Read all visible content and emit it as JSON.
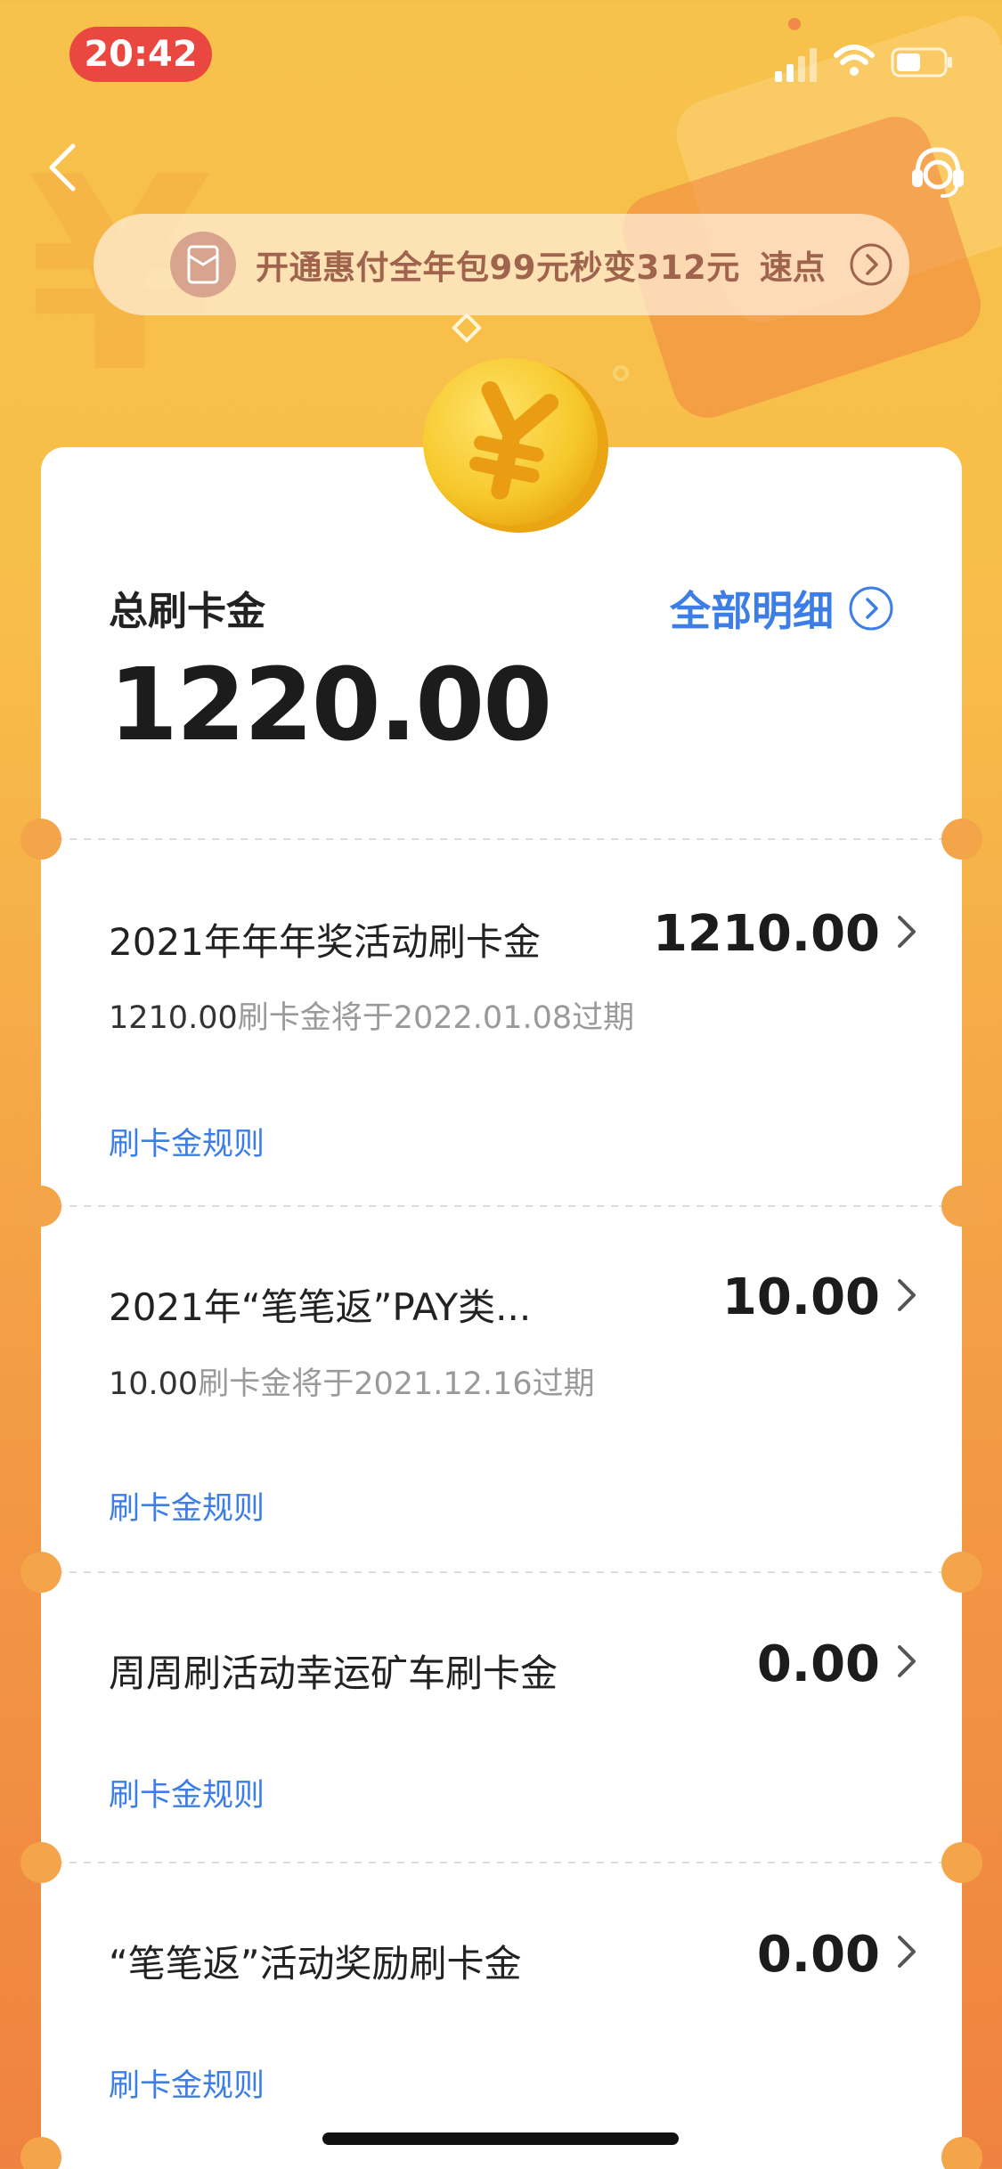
{
  "status_bar": {
    "time": "20:42"
  },
  "promo": {
    "text": "开通惠付全年包99元秒变312元",
    "cta": "速点"
  },
  "summary": {
    "label": "总刷卡金",
    "detail_link": "全部明细",
    "total": "1220.00"
  },
  "items": [
    {
      "title": "2021年年年奖活动刷卡金",
      "amount": "1210.00",
      "sub_amount": "1210.00",
      "sub_rest": "刷卡金将于2022.01.08过期",
      "rule": "刷卡金规则"
    },
    {
      "title": "2021年“笔笔返”PAY类...",
      "amount": "10.00",
      "sub_amount": "10.00",
      "sub_rest": "刷卡金将于2021.12.16过期",
      "rule": "刷卡金规则"
    },
    {
      "title": "周周刷活动幸运矿车刷卡金",
      "amount": "0.00",
      "rule": "刷卡金规则"
    },
    {
      "title": "“笔笔返”活动奖励刷卡金",
      "amount": "0.00",
      "rule": "刷卡金规则"
    }
  ],
  "colors": {
    "accent_blue": "#3c7ee6",
    "time_pill": "#e9473f",
    "promo_text": "#a0644e"
  }
}
